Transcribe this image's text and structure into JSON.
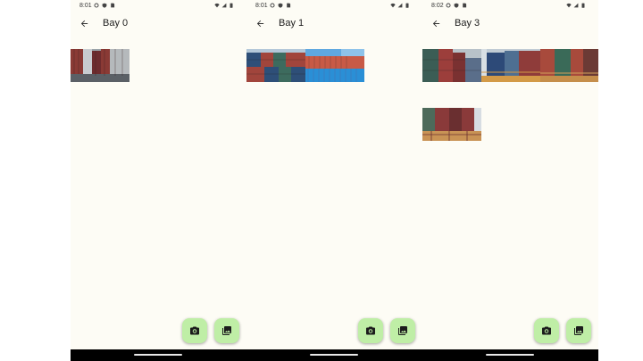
{
  "screens": [
    {
      "status_time": "8:01",
      "title": "Bay 0",
      "photos": [
        {
          "name": "container-photo-0",
          "palette": [
            "#8a3a35",
            "#6d2c2e",
            "#9aa3a8",
            "#c8ccd0",
            "#5b6066"
          ]
        }
      ]
    },
    {
      "status_time": "8:01",
      "title": "Bay 1",
      "photos": [
        {
          "name": "container-photo-0",
          "palette": [
            "#2e4f78",
            "#a1453c",
            "#3d6b5e",
            "#8b8f8a",
            "#b4c8d9"
          ]
        },
        {
          "name": "container-photo-1",
          "palette": [
            "#2a8fd6",
            "#c85a46",
            "#3a7ec2",
            "#5fa8e0",
            "#9b4c3e"
          ]
        }
      ]
    },
    {
      "status_time": "8:02",
      "title": "Bay 3",
      "photos": [
        {
          "name": "container-photo-0",
          "palette": [
            "#3b5d55",
            "#9c3e3b",
            "#5a6e8a",
            "#b8c2c9",
            "#7a3131"
          ]
        },
        {
          "name": "container-photo-1",
          "palette": [
            "#2d4a78",
            "#8f3c3a",
            "#d39a47",
            "#4e6f92",
            "#c0cbd4"
          ]
        },
        {
          "name": "container-photo-2",
          "palette": [
            "#3a6a58",
            "#a84a3c",
            "#c58e4b",
            "#6b3a35",
            "#d4a35a"
          ]
        },
        {
          "name": "container-photo-3",
          "palette": [
            "#8a3a3a",
            "#4d6a5a",
            "#c99355",
            "#b9c3cb",
            "#6a2f30"
          ]
        }
      ]
    }
  ],
  "icons": {
    "back": "arrow-back-icon",
    "camera": "camera-icon",
    "gallery": "photo-library-icon"
  },
  "colors": {
    "background": "#fdfcf5",
    "fab": "#bfeea6",
    "nav_bar": "#000000"
  }
}
